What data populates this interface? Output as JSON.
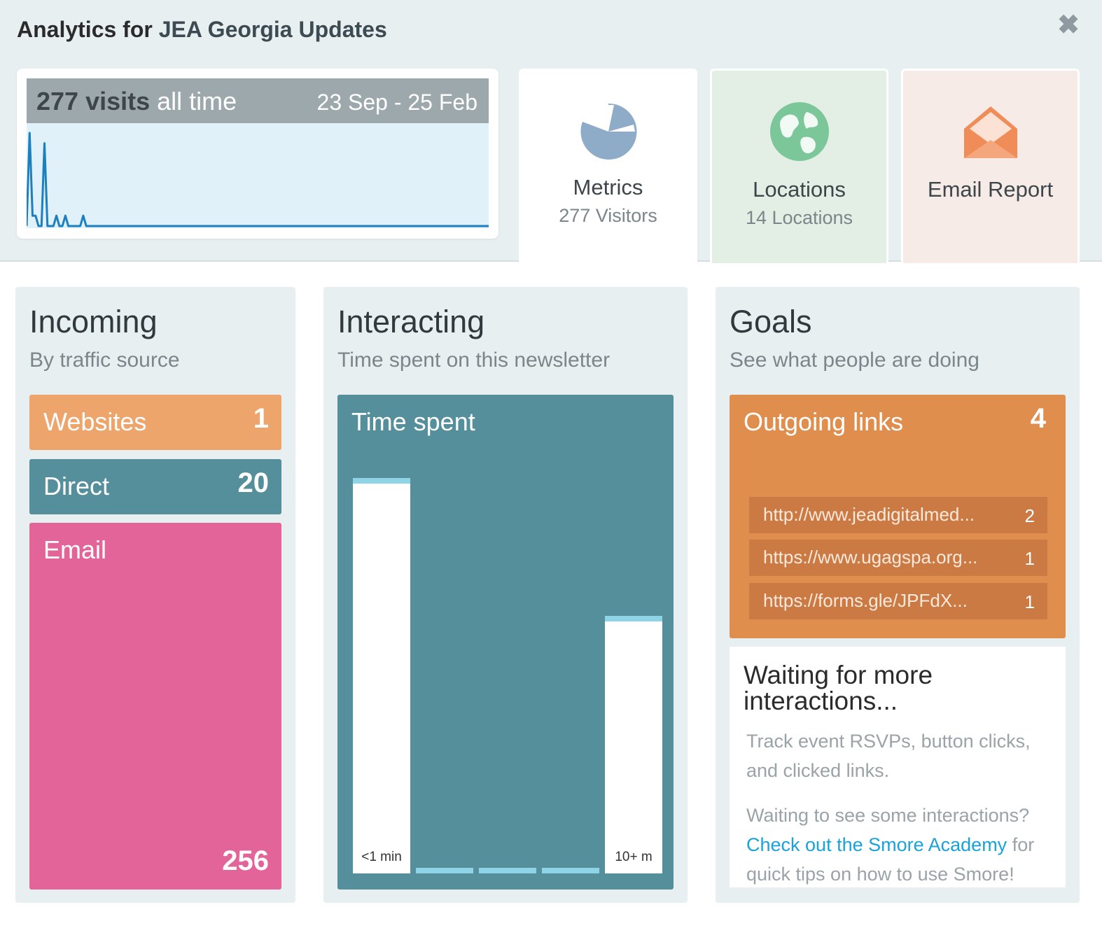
{
  "header": {
    "title_prefix": "Analytics for",
    "title_name": "JEA Georgia Updates",
    "close_symbol": "✖"
  },
  "visits": {
    "count": "277 visits",
    "period": "all time",
    "range": "23 Sep - 25 Feb",
    "chart_color": "#1b7fc0",
    "daily_series": [
      0,
      9,
      1,
      1,
      0,
      0,
      8,
      0,
      0,
      0,
      1,
      0,
      0,
      1,
      0,
      0,
      0,
      0,
      0,
      1,
      0,
      0,
      0,
      0,
      0,
      0,
      0,
      0,
      0,
      0,
      0,
      0,
      0,
      0,
      0,
      0,
      0,
      0,
      0,
      0,
      0,
      0,
      0,
      0,
      0,
      0,
      0,
      0,
      0,
      0,
      0,
      0,
      0,
      0,
      0,
      0,
      0,
      0,
      0,
      0,
      0,
      0,
      0,
      0,
      0,
      0,
      0,
      0,
      0,
      0,
      0,
      0,
      0,
      0,
      0,
      0,
      0,
      0,
      0,
      0,
      0,
      0,
      0,
      0,
      0,
      0,
      0,
      0,
      0,
      0,
      0,
      0,
      0,
      0,
      0,
      0,
      0,
      0,
      0,
      0,
      0,
      0,
      0,
      0,
      0,
      0,
      0,
      0,
      0,
      0,
      0,
      0,
      0,
      0,
      0,
      0,
      0,
      0,
      0,
      0,
      0,
      0,
      0,
      0,
      0,
      0,
      0,
      0,
      0,
      0,
      0,
      0,
      0,
      0,
      0,
      0,
      0,
      0,
      0,
      0,
      0,
      0,
      0,
      0,
      0,
      0,
      0,
      0,
      0,
      0,
      0,
      0,
      0,
      0,
      0,
      0
    ]
  },
  "tabs": [
    {
      "label": "Metrics",
      "sub": "277 Visitors",
      "icon": "pie-chart-icon",
      "color": "#8eabc8"
    },
    {
      "label": "Locations",
      "sub": "14 Locations",
      "icon": "globe-icon",
      "color": "#7cc79a"
    },
    {
      "label": "Email Report",
      "sub": "",
      "icon": "envelope-icon",
      "color": "#ef8c57"
    }
  ],
  "incoming": {
    "title": "Incoming",
    "subtitle": "By traffic source",
    "sources": [
      {
        "label": "Websites",
        "count": "1",
        "color": "#eda56c"
      },
      {
        "label": "Direct",
        "count": "20",
        "color": "#558f9c"
      },
      {
        "label": "Email",
        "count": "256",
        "color": "#e26498"
      }
    ]
  },
  "interacting": {
    "title": "Interacting",
    "subtitle": "Time spent on this newsletter",
    "box_title": "Time spent",
    "buckets": [
      {
        "label": "<1 min",
        "share": 0.96
      },
      {
        "label": "",
        "share": 0.0
      },
      {
        "label": "",
        "share": 0.0
      },
      {
        "label": "",
        "share": 0.0
      },
      {
        "label": "10+ m",
        "share": 0.62
      }
    ]
  },
  "goals": {
    "title": "Goals",
    "subtitle": "See what people are doing",
    "outgoing_title": "Outgoing links",
    "outgoing_count": "4",
    "links": [
      {
        "url": "http://www.jeadigitalmed...",
        "count": "2"
      },
      {
        "url": "https://www.ugagspa.org...",
        "count": "1"
      },
      {
        "url": "https://forms.gle/JPFdX...",
        "count": "1"
      }
    ],
    "waiting_title": "Waiting for more interactions...",
    "waiting_text": "Track event RSVPs, button clicks, and clicked links.",
    "waiting_text2": "Waiting to see some interactions?",
    "academy_link": "Check out the Smore Academy",
    "waiting_text3": "for quick tips on how to use Smore!"
  }
}
